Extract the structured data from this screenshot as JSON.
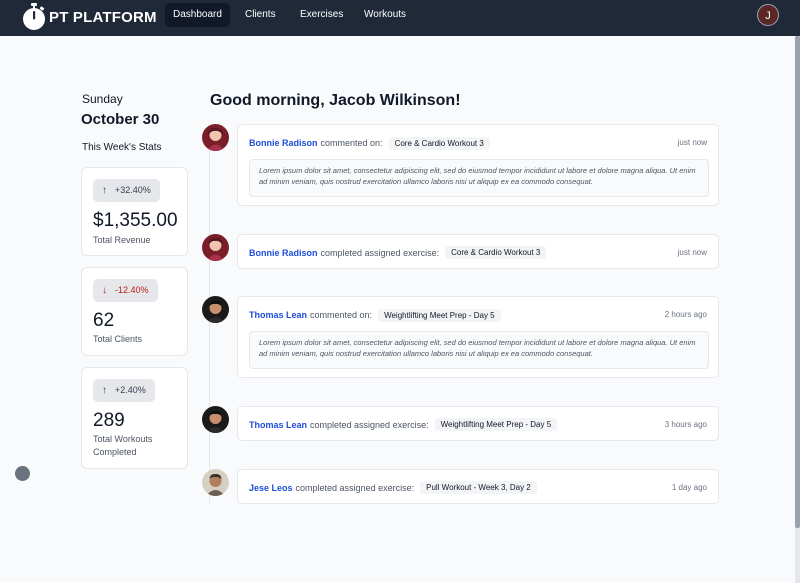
{
  "nav": {
    "brand": "PT PLATFORM",
    "links": [
      "Dashboard",
      "Clients",
      "Exercises",
      "Workouts"
    ],
    "user_initial": "J"
  },
  "sidebar": {
    "day": "Sunday",
    "date": "October 30",
    "stats_heading": "This Week's Stats",
    "stats": [
      {
        "change": "+32.40%",
        "direction": "up",
        "value": "$1,355.00",
        "label": "Total Revenue"
      },
      {
        "change": "-12.40%",
        "direction": "down",
        "value": "62",
        "label": "Total Clients"
      },
      {
        "change": "+2.40%",
        "direction": "up",
        "value": "289",
        "label": "Total Workouts Completed"
      }
    ]
  },
  "feed": {
    "greeting": "Good morning, Jacob Wilkinson!",
    "items": [
      {
        "user": "Bonnie Radison",
        "action": "commented on:",
        "tag": "Core & Cardio Workout 3",
        "time": "just now",
        "comment": "Lorem ipsum dolor sit amet, consectetur adipiscing elit, sed do eiusmod tempor incididunt ut labore et dolore magna aliqua. Ut enim ad minim veniam, quis nostrud exercitation ullamco laboris nisi ut aliquip ex ea commodo consequat."
      },
      {
        "user": "Bonnie Radison",
        "action": "completed assigned exercise:",
        "tag": "Core & Cardio Workout 3",
        "time": "just now"
      },
      {
        "user": "Thomas Lean",
        "action": "commented on:",
        "tag": "Weightlifting Meet Prep - Day 5",
        "time": "2 hours ago",
        "comment": "Lorem ipsum dolor sit amet, consectetur adipiscing elit, sed do eiusmod tempor incididunt ut labore et dolore magna aliqua. Ut enim ad minim veniam, quis nostrud exercitation ullamco laboris nisi ut aliquip ex ea commodo consequat."
      },
      {
        "user": "Thomas Lean",
        "action": "completed assigned exercise:",
        "tag": "Weightlifting Meet Prep - Day 5",
        "time": "3 hours ago"
      },
      {
        "user": "Jese Leos",
        "action": "completed assigned exercise:",
        "tag": "Pull Workout - Week 3, Day 2",
        "time": "1 day ago"
      }
    ]
  },
  "colors": {
    "navbar": "#1f2937",
    "accent_link": "#1d4ed8",
    "negative": "#b91c1c"
  },
  "icons": {
    "brand": "stopwatch-icon",
    "up": "arrow-up-icon",
    "down": "arrow-down-icon"
  }
}
